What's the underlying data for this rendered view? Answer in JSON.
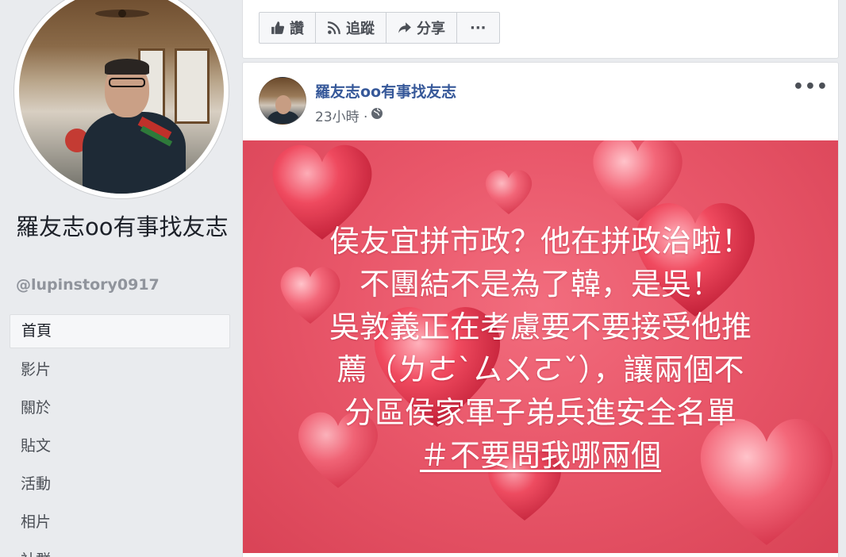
{
  "profile": {
    "name": "羅友志oo有事找友志",
    "handle": "@lupinstory0917"
  },
  "sidebar": {
    "items": [
      {
        "label": "首頁",
        "active": true
      },
      {
        "label": "影片"
      },
      {
        "label": "關於"
      },
      {
        "label": "貼文"
      },
      {
        "label": "活動"
      },
      {
        "label": "相片"
      },
      {
        "label": "社群"
      }
    ]
  },
  "actions": {
    "like": "讚",
    "follow": "追蹤",
    "share": "分享",
    "more": "···"
  },
  "post": {
    "author": "羅友志oo有事找友志",
    "time": "23小時 ·",
    "privacy_icon": "globe-icon",
    "more": "•••",
    "image_lines": [
      "侯友宜拼市政？他在拼政治啦！",
      "不團結不是為了韓，是吳！",
      "吳敦義正在考慮要不要接受他推",
      "薦（ㄌㄜˋㄙㄨㄛˇ），讓兩個不",
      "分區侯家軍子弟兵進安全名單",
      "＃不要問我哪兩個"
    ]
  },
  "colors": {
    "page_bg": "#e9ebee",
    "link_blue": "#365899",
    "image_red": "#e9576a"
  }
}
